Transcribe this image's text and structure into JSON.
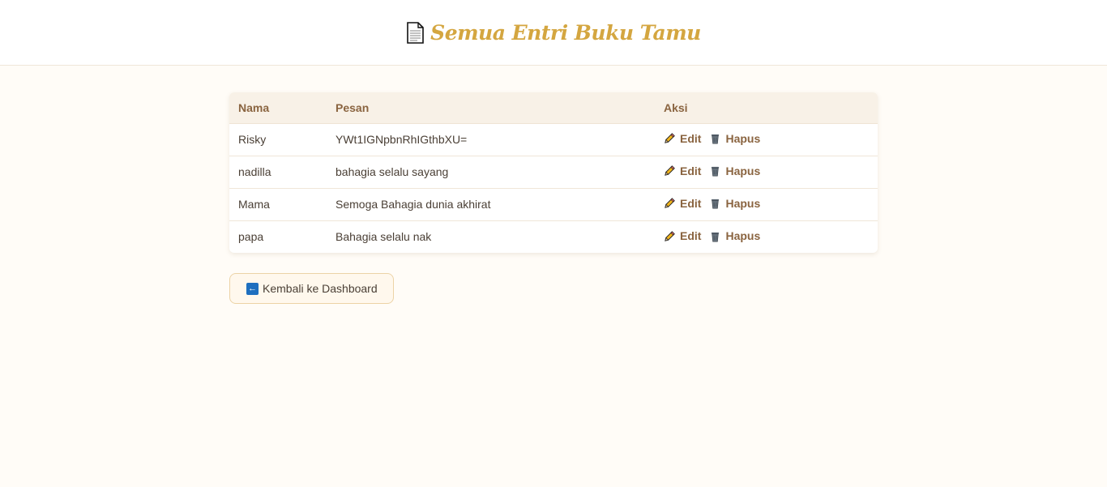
{
  "header": {
    "title": "Semua Entri Buku Tamu",
    "icon": "document-icon"
  },
  "table": {
    "columns": [
      "Nama",
      "Pesan",
      "Aksi"
    ],
    "rows": [
      {
        "nama": "Risky",
        "pesan": "YWt1IGNpbnRhIGthbXU=",
        "edit": "Edit",
        "hapus": "Hapus"
      },
      {
        "nama": "nadilla",
        "pesan": "bahagia selalu sayang",
        "edit": "Edit",
        "hapus": "Hapus"
      },
      {
        "nama": "Mama",
        "pesan": "Semoga Bahagia dunia akhirat",
        "edit": "Edit",
        "hapus": "Hapus"
      },
      {
        "nama": "papa",
        "pesan": "Bahagia selalu nak",
        "edit": "Edit",
        "hapus": "Hapus"
      }
    ]
  },
  "back_button": {
    "label": "Kembali ke Dashboard",
    "icon": "left-arrow-icon"
  },
  "colors": {
    "accent": "#d4a640",
    "link": "#8a6440",
    "background": "#fffcf7"
  }
}
